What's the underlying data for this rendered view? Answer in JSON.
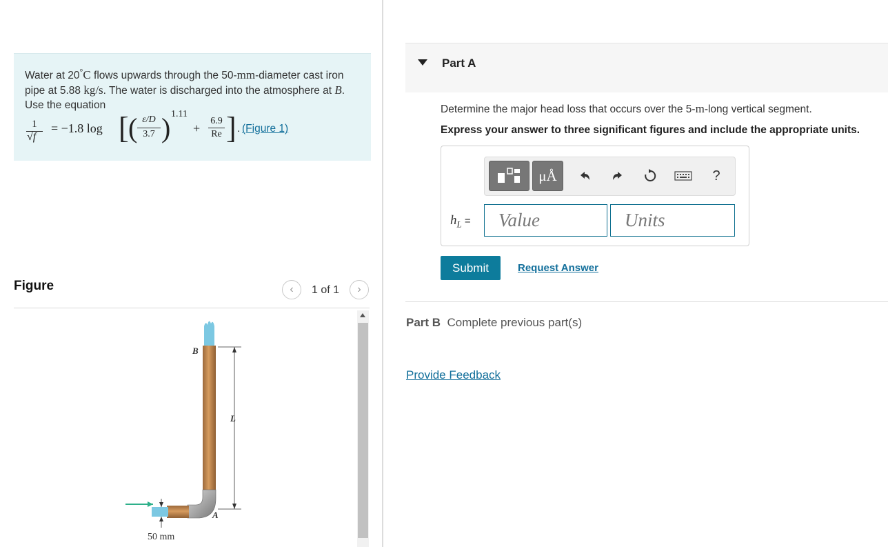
{
  "problem": {
    "line1_pre": "Water at 20",
    "deg": "°",
    "unitC": "C",
    "line1_mid": " flows upwards through the 50-",
    "mm": "mm",
    "line1_post": "-diameter cast iron pipe at 5.88 ",
    "kgs": "kg/s",
    "line2": ". The water is discharged into the atmosphere at ",
    "B": "B",
    "line3": ". Use the equation",
    "eq_num": "1",
    "eq_den": "√f",
    "eq_rhs": "= −1.8 log",
    "eq_eps_num": "ε/D",
    "eq_eps_den": "3.7",
    "eq_exp": "1.11",
    "eq_plus": "+",
    "eq_num2": "6.9",
    "eq_den2": "Re",
    "eq_period": ".",
    "figure_link": "(Figure 1)"
  },
  "figure": {
    "title": "Figure",
    "counter": "1 of 1",
    "label_B": "B",
    "label_L": "L",
    "label_A": "A",
    "label_dim": "50 mm",
    "prev_icon": "chevron-left-icon",
    "next_icon": "chevron-right-icon"
  },
  "partA": {
    "title": "Part A",
    "question_pre": "Determine the major head loss that occurs over the 5-",
    "question_unit": "m",
    "question_post": "-long vertical segment.",
    "instruction": "Express your answer to three significant figures and include the appropriate units.",
    "toolbar": {
      "unit_btn": "μÅ",
      "help": "?"
    },
    "hl_var": "h",
    "hl_sub": "L",
    "hl_eq": " =",
    "value_placeholder": "Value",
    "units_placeholder": "Units",
    "submit": "Submit",
    "request_answer": "Request Answer"
  },
  "partB": {
    "title": "Part B",
    "status": "Complete previous part(s)"
  },
  "feedback": "Provide Feedback",
  "colors": {
    "accent": "#0d7c9c",
    "link": "#126f9b",
    "problem_bg": "#e6f4f6"
  }
}
